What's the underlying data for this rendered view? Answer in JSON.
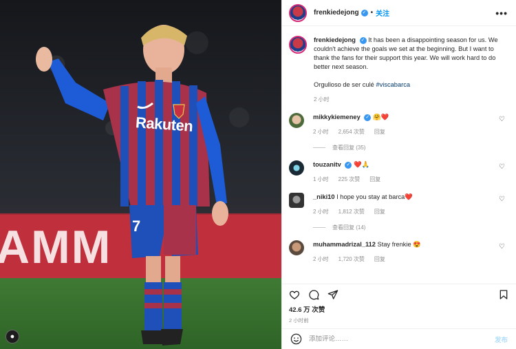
{
  "header": {
    "username": "frenkiedejong",
    "dot": "•",
    "follow": "关注",
    "more": "•••"
  },
  "caption": {
    "username": "frenkiedejong",
    "text": "It has been a disappointing season for us. We couldn't achieve the goals we set at the beginning. But I want to thank the fans for their support this year. We will work hard to do better next season.",
    "line2": "Orgulloso de ser culé",
    "hashtag": "#viscabarca",
    "time": "2 小时"
  },
  "comments": [
    {
      "username": "mikkykiemeney",
      "text": "",
      "emoji": "🤗❤️",
      "time": "2 小时",
      "likes": "2,654 次赞",
      "reply": "回复",
      "view_replies": "查看回复 (35)"
    },
    {
      "username": "touzanitv",
      "text": "",
      "emoji": "❤️🙏",
      "time": "1 小时",
      "likes": "225 次赞",
      "reply": "回复",
      "view_replies": ""
    },
    {
      "username": "_niki10",
      "text": "I hope you stay at barca",
      "emoji": "❤️",
      "time": "2 小时",
      "likes": "1,812 次赞",
      "reply": "回复",
      "view_replies": "查看回复 (14)"
    },
    {
      "username": "muhammadrizal_112",
      "text": "Stay frenkie",
      "emoji": "😍",
      "time": "2 小时",
      "likes": "1,720 次赞",
      "reply": "回复",
      "view_replies": ""
    }
  ],
  "likes": "42.6 万 次赞",
  "posted": "2 小时前",
  "compose": {
    "placeholder": "添加评论……",
    "post": "发布"
  },
  "photo": {
    "jersey_text": "Rakuten",
    "board_text": "AMM",
    "number": "7"
  }
}
